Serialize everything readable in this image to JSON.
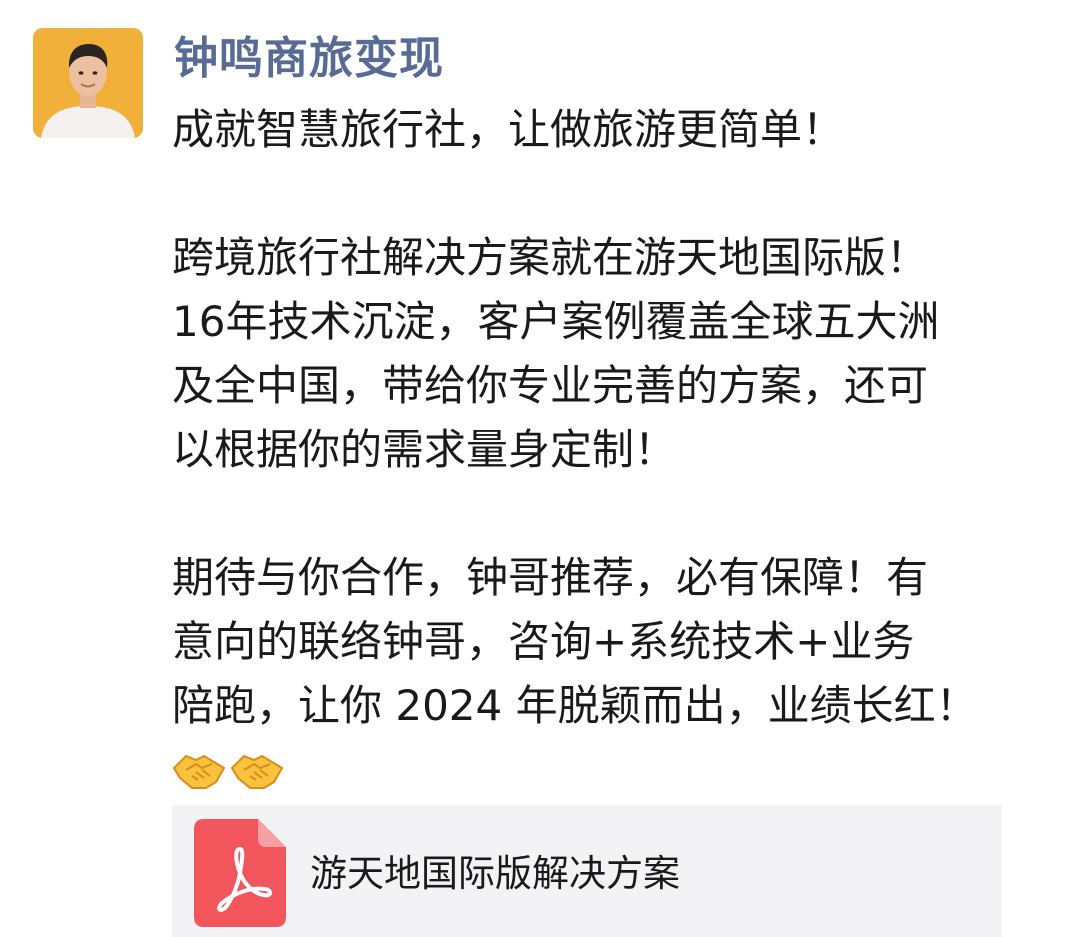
{
  "post": {
    "author": "钟鸣商旅变现",
    "avatar_icon": "person-photo",
    "paragraphs": [
      [
        "成就智慧旅行社，让做旅游更简单！"
      ],
      [
        "跨境旅行社解决方案就在游天地国际版！",
        "16年技术沉淀，客户案例覆盖全球五大洲",
        "及全中国，带给你专业完善的方案，还可",
        "以根据你的需求量身定制！"
      ],
      [
        "期待与你合作，钟哥推荐，必有保障！有",
        "意向的联络钟哥，咨询+系统技术+业务",
        "陪跑，让你 2024 年脱颖而出，业绩长红！"
      ]
    ],
    "emojis": [
      "handshake-icon",
      "handshake-icon"
    ]
  },
  "attachment": {
    "icon": "pdf-file-icon",
    "icon_color": "#f2555c",
    "file_name": "游天地国际版解决方案"
  },
  "colors": {
    "author": "#576b95",
    "text": "#1a1a1a",
    "attachment_bg": "#f3f3f5"
  }
}
